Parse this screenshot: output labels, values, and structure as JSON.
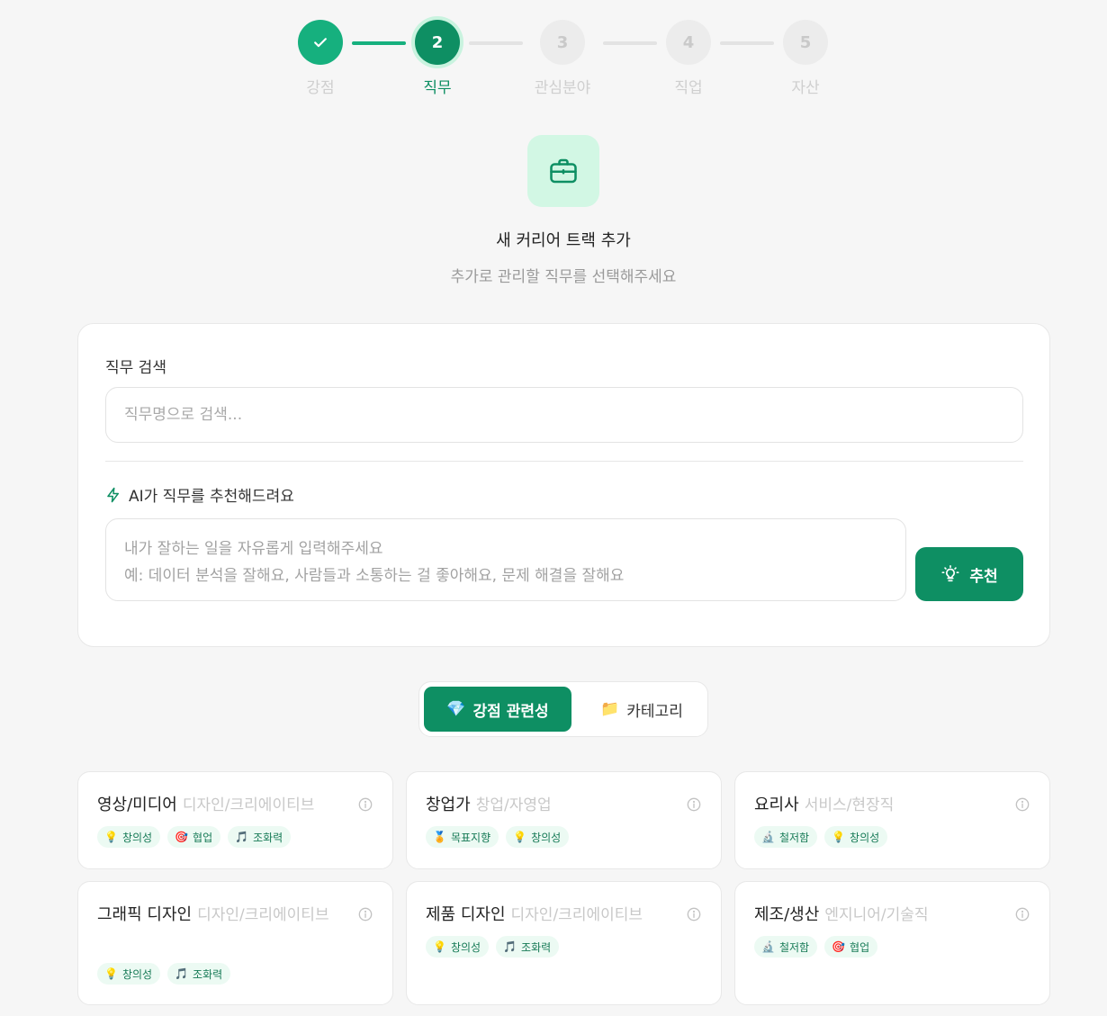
{
  "stepper": {
    "steps": [
      {
        "number": "✓",
        "label": "강점",
        "state": "done"
      },
      {
        "number": "2",
        "label": "직무",
        "state": "active"
      },
      {
        "number": "3",
        "label": "관심분야",
        "state": "pending"
      },
      {
        "number": "4",
        "label": "직업",
        "state": "pending"
      },
      {
        "number": "5",
        "label": "자산",
        "state": "pending"
      }
    ]
  },
  "hero": {
    "icon": "briefcase-icon",
    "title": "새 커리어 트랙 추가",
    "subtitle": "추가로 관리할 직무를 선택해주세요"
  },
  "search": {
    "label": "직무 검색",
    "placeholder": "직무명으로 검색..."
  },
  "ai": {
    "icon": "lightning-icon",
    "label": "AI가 직무를 추천해드려요",
    "placeholder": "내가 잘하는 일을 자유롭게 입력해주세요\n예: 데이터 분석을 잘해요, 사람들과 소통하는 걸 좋아해요, 문제 해결을 잘해요",
    "button_label": "추천",
    "button_icon": "lightbulb-icon"
  },
  "view_toggle": {
    "options": [
      {
        "icon": "💎",
        "label": "강점 관련성",
        "active": true
      },
      {
        "icon": "📁",
        "label": "카테고리",
        "active": false
      }
    ]
  },
  "jobs": [
    {
      "title": "영상/미디어",
      "category": "디자인/크리에이티브",
      "tags": [
        {
          "icon": "💡",
          "label": "창의성"
        },
        {
          "icon": "🎯",
          "label": "협업"
        },
        {
          "icon": "🎵",
          "label": "조화력"
        }
      ]
    },
    {
      "title": "창업가",
      "category": "창업/자영업",
      "tags": [
        {
          "icon": "🏅",
          "label": "목표지향"
        },
        {
          "icon": "💡",
          "label": "창의성"
        }
      ]
    },
    {
      "title": "요리사",
      "category": "서비스/현장직",
      "tags": [
        {
          "icon": "🔬",
          "label": "철저함"
        },
        {
          "icon": "💡",
          "label": "창의성"
        }
      ]
    },
    {
      "title": "그래픽 디자인",
      "category": "디자인/크리에이티브",
      "tags": [
        {
          "icon": "💡",
          "label": "창의성"
        },
        {
          "icon": "🎵",
          "label": "조화력"
        }
      ]
    },
    {
      "title": "제품 디자인",
      "category": "디자인/크리에이티브",
      "tags": [
        {
          "icon": "💡",
          "label": "창의성"
        },
        {
          "icon": "🎵",
          "label": "조화력"
        }
      ]
    },
    {
      "title": "제조/생산",
      "category": "엔지니어/기술직",
      "tags": [
        {
          "icon": "🔬",
          "label": "철저함"
        },
        {
          "icon": "🎯",
          "label": "협업"
        }
      ]
    }
  ],
  "colors": {
    "primary": "#0e8f63",
    "primary_light": "#16b07e",
    "icon_bg": "#d2f7e4",
    "tag_bg": "#ecfaf3"
  }
}
